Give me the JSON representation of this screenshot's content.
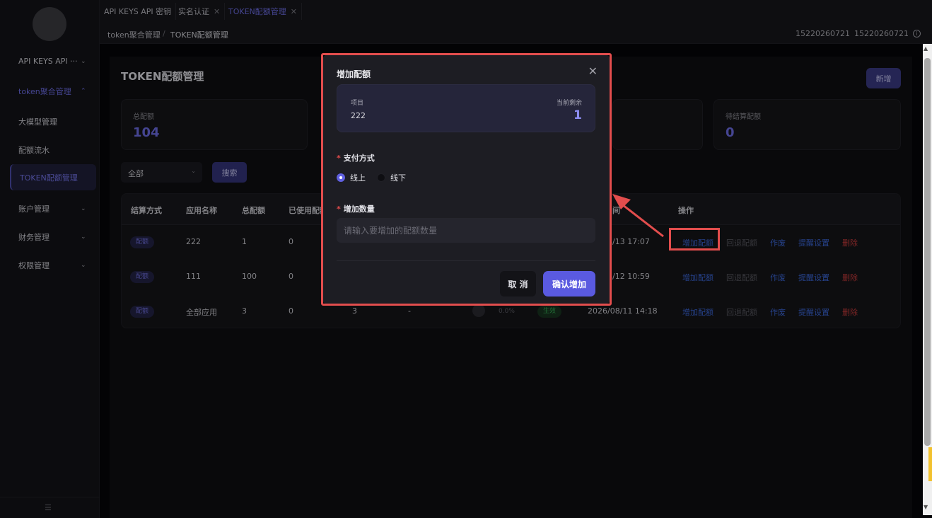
{
  "sidebar": {
    "items": [
      {
        "label": "API KEYS API ···",
        "chevron": "⌄"
      },
      {
        "label": "token聚合管理",
        "chevron": "⌃"
      },
      {
        "label": "大模型管理"
      },
      {
        "label": "配额流水"
      },
      {
        "label": "TOKEN配额管理"
      },
      {
        "label": "账户管理",
        "chevron": "⌄"
      },
      {
        "label": "财务管理",
        "chevron": "⌄"
      },
      {
        "label": "权限管理",
        "chevron": "⌄"
      }
    ],
    "collapse_icon": "☰"
  },
  "tabs": [
    {
      "label": "API KEYS API 密钥"
    },
    {
      "label": "实名认证",
      "close": "✕"
    },
    {
      "label": "TOKEN配额管理",
      "close": "✕"
    }
  ],
  "breadcrumb": {
    "parent": "token聚合管理",
    "sep": "/",
    "current": "TOKEN配额管理"
  },
  "user": {
    "name1": "15220260721",
    "name2": "15220260721",
    "icon": "i"
  },
  "page": {
    "title": "TOKEN配额管理",
    "new_button": "新增"
  },
  "stats": [
    {
      "label": "总配额",
      "value": "104"
    },
    {
      "label": "待结算配额",
      "value": "0"
    }
  ],
  "filter": {
    "select_value": "全部",
    "caret": "⌄",
    "search_button": "搜索"
  },
  "table": {
    "headers": [
      "结算方式",
      "应用名称",
      "总配额",
      "已使用配额",
      "间",
      "操作"
    ],
    "rows": [
      {
        "type": "配额",
        "app": "222",
        "total": "1",
        "used": "0",
        "time": "8/13 17:07"
      },
      {
        "type": "配额",
        "app": "111",
        "total": "100",
        "used": "0",
        "time": "8/12 10:59"
      },
      {
        "type": "配额",
        "app": "全部应用",
        "total": "3",
        "used": "0",
        "remain": "3",
        "dash": "-",
        "pct": "0.0%",
        "status": "生效",
        "time": "2026/08/11 14:18"
      }
    ],
    "ops": [
      "增加配额",
      "回退配额",
      "作废",
      "提醒设置",
      "删除"
    ]
  },
  "modal": {
    "title": "增加配额",
    "close": "✕",
    "project_label": "项目",
    "project_value": "222",
    "remain_label": "当前剩余",
    "remain_value": "1",
    "pay_label": "支付方式",
    "pay_options": [
      "线上",
      "线下"
    ],
    "qty_label": "增加数量",
    "qty_placeholder": "请输入要增加的配额数量",
    "cancel": "取 消",
    "confirm": "确认增加"
  },
  "colors": {
    "accent": "#5a5ae0",
    "annotation": "#e24d4d"
  }
}
